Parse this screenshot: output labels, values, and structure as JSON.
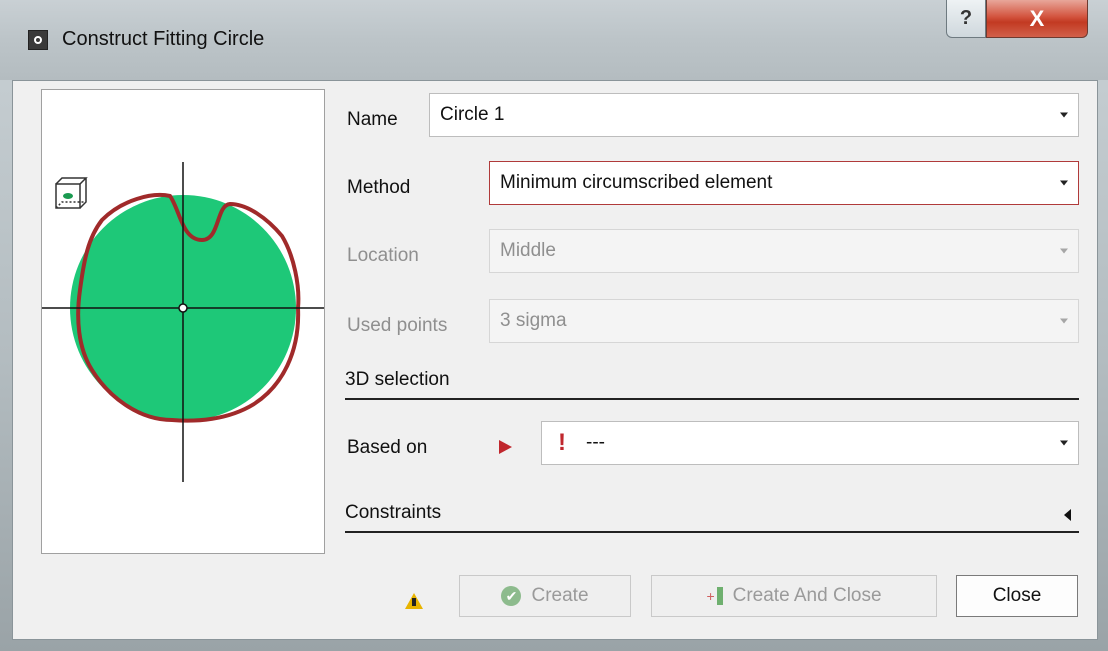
{
  "window": {
    "title": "Construct Fitting Circle",
    "help_label": "?",
    "close_label": "X"
  },
  "form": {
    "name_label": "Name",
    "name_value": "Circle 1",
    "method_label": "Method",
    "method_value": "Minimum circumscribed element",
    "location_label": "Location",
    "location_value": "Middle",
    "used_points_label": "Used points",
    "used_points_value": "3 sigma"
  },
  "sections": {
    "selection_3d": "3D selection",
    "constraints": "Constraints"
  },
  "based_on": {
    "label": "Based on",
    "marker": "!",
    "value": "---"
  },
  "buttons": {
    "create": "Create",
    "create_and_close": "Create And Close",
    "close": "Close"
  },
  "colors": {
    "circle_fill": "#1ec878",
    "profile_line": "#a02a2a",
    "error_accent": "#c0272d",
    "warning": "#e8b400"
  }
}
